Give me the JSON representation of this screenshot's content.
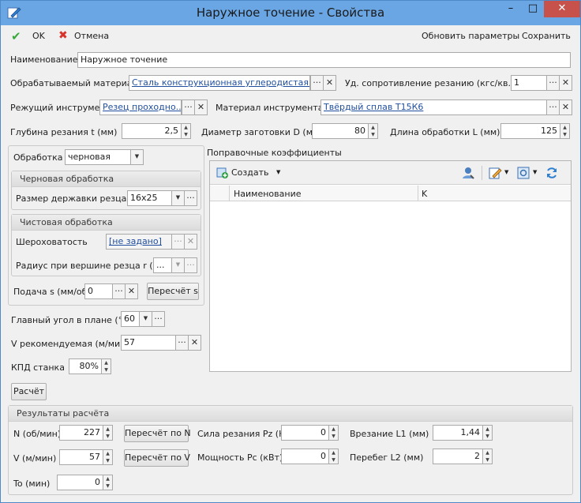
{
  "window": {
    "title": "Наружное точение - Свойства",
    "minimize": "–",
    "maximize": "□",
    "close": "✕",
    "icon": "pencil-icon"
  },
  "toolbar": {
    "ok": "OK",
    "cancel": "Отмена",
    "update": "Обновить параметры",
    "save": "Сохранить"
  },
  "form": {
    "name_label": "Наименование",
    "name_value": "Наружное точение",
    "material_label": "Обрабатываемый материал",
    "material_value": "Сталь конструкционная углеродистая к...",
    "resist_label": "Уд. сопротивление резанию (кгс/кв.мм)",
    "resist_value": "1",
    "tool_label": "Режущий инструмент",
    "tool_value": "Резец проходно...",
    "tool_mat_label": "Материал  инструмента",
    "tool_mat_value": "Твёрдый сплав Т15К6",
    "depth_label": "Глубина резания t (мм)",
    "depth_value": "2,5",
    "diam_label": "Диаметр заготовки D (мм)",
    "diam_value": "80",
    "length_label": "Длина обработки L (мм)",
    "length_value": "125"
  },
  "left": {
    "mode_label": "Обработка",
    "mode_value": "черновая",
    "rough_title": "Черновая обработка",
    "holder_label": "Размер державки резца",
    "holder_value": "16x25",
    "finish_title": "Чистовая обработка",
    "rough_label": "Шероховатость",
    "rough_value": "[не задано]",
    "radius_label": "Радиус при вершине резца r (мм)",
    "radius_value": "...",
    "feed_label": "Подача s (мм/об)",
    "feed_value": "0",
    "feed_btn": "Пересчёт s",
    "angle_label": "Главный угол в плане (°)",
    "angle_value": "60",
    "v_label": "V рекомендуемая (м/мин)",
    "v_value": "57",
    "eff_label": "КПД станка",
    "eff_value": "80%",
    "calc_btn": "Расчёт"
  },
  "coef": {
    "title": "Поправочные коэффициенты",
    "create": "Создать",
    "col_name": "Наименование",
    "col_k": "K"
  },
  "results": {
    "title": "Результаты расчёта",
    "n_label": "N (об/мин)",
    "n_value": "227",
    "n_btn": "Пересчёт по N",
    "v_label": "V (м/мин)",
    "v_value": "57",
    "v_btn": "Пересчёт по V",
    "t_label": "To (мин)",
    "t_value": "0",
    "pz_label": "Сила резания Pz (Н)",
    "pz_value": "0",
    "pc_label": "Мощность Pc (кВт)",
    "pc_value": "0",
    "l1_label": "Врезание L1 (мм)",
    "l1_value": "1,44",
    "l2_label": "Перебег L2 (мм)",
    "l2_value": "2"
  },
  "icons": {
    "ellipsis": "···",
    "clear": "✕",
    "up": "▲",
    "down": "▼",
    "dropdown": "▼",
    "check": "✔",
    "cross": "✖"
  },
  "colors": {
    "titlebar": "#6aa6e4",
    "link": "#1f4e9e",
    "close": "#c7514b"
  }
}
